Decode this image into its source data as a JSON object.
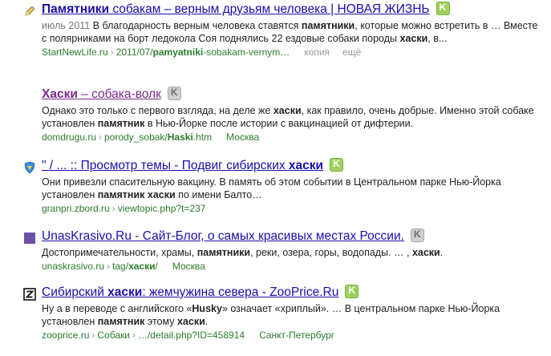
{
  "results": [
    {
      "title_parts": [
        {
          "text": "Памятники",
          "bold": true
        },
        {
          "text": " собакам – верным друзьям человека | НОВАЯ ЖИЗНЬ",
          "bold": false
        }
      ],
      "visited": false,
      "bookmark_color": "green",
      "favicon": "pencil-icon",
      "snippet_parts": [
        {
          "text": "июль 2011",
          "date": true
        },
        {
          "text": " В благодарность верным человека ставятся "
        },
        {
          "text": "памятники",
          "bold": true
        },
        {
          "text": ", которые можно встретить в … Вместе с полярниками на борт ледокола Соя поднялись 22 ездовые собаки породы "
        },
        {
          "text": "хаски",
          "bold": true
        },
        {
          "text": ", в..."
        }
      ],
      "url_parts": [
        {
          "text": "StartNewLife.ru"
        },
        {
          "text": "›",
          "chev": true
        },
        {
          "text": "2011/07/"
        },
        {
          "text": "pamyatniki",
          "bold": true
        },
        {
          "text": "-sobakam-vernym…"
        }
      ],
      "extra": "копия",
      "more": "ещё"
    },
    {
      "title_parts": [
        {
          "text": "Хаски",
          "bold": true
        },
        {
          "text": " – собака-волк",
          "bold": false
        }
      ],
      "visited": true,
      "bookmark_color": "gray",
      "favicon": "",
      "snippet_parts": [
        {
          "text": "Однако это только с первого взгляда, на деле же "
        },
        {
          "text": "хаски",
          "bold": true
        },
        {
          "text": ", как правило, очень добрые. Именно этой собаке установлен "
        },
        {
          "text": "памятник",
          "bold": true
        },
        {
          "text": " в Нью-Йорке после истории с вакцинацией от дифтерии."
        }
      ],
      "url_parts": [
        {
          "text": "domdrugu.ru"
        },
        {
          "text": "›",
          "chev": true
        },
        {
          "text": "porody_sobak/"
        },
        {
          "text": "Haski",
          "bold": true
        },
        {
          "text": ".htm"
        }
      ],
      "extra": "Москва",
      "more": ""
    },
    {
      "title_parts": [
        {
          "text": "\" / ... :: Просмотр темы - Подвиг сибирских ",
          "bold": false
        },
        {
          "text": "хаски",
          "bold": true
        }
      ],
      "visited": false,
      "bookmark_color": "green",
      "favicon": "shield-icon",
      "snippet_parts": [
        {
          "text": "Они привезли спасительную вакцину. В память об этом событии в Центральном парке Нью-Йорка установлен "
        },
        {
          "text": "памятник",
          "bold": true
        },
        {
          "text": " "
        },
        {
          "text": "хаски",
          "bold": true
        },
        {
          "text": " по имени Балто…"
        }
      ],
      "url_parts": [
        {
          "text": "granpri.zbord.ru"
        },
        {
          "text": "›",
          "chev": true
        },
        {
          "text": "viewtopic.php?t=237"
        }
      ],
      "extra": "",
      "more": ""
    },
    {
      "title_parts": [
        {
          "text": "UnasKrasivo.Ru - Сайт-Блог, о самых красивых местах России.",
          "bold": false
        }
      ],
      "visited": false,
      "bookmark_color": "gray",
      "favicon": "purple-square-icon",
      "snippet_parts": [
        {
          "text": "Достопримечательности, храмы, "
        },
        {
          "text": "памятники",
          "bold": true
        },
        {
          "text": ", реки, озера, горы, водопады. … , "
        },
        {
          "text": "хаски",
          "bold": true
        },
        {
          "text": "."
        }
      ],
      "url_parts": [
        {
          "text": "unaskrasivo.ru"
        },
        {
          "text": "›",
          "chev": true
        },
        {
          "text": "tag/"
        },
        {
          "text": "хаски",
          "bold": true
        },
        {
          "text": "/"
        }
      ],
      "extra": "Москва",
      "more": ""
    },
    {
      "title_parts": [
        {
          "text": "Сибирский ",
          "bold": false
        },
        {
          "text": "хаски",
          "bold": true
        },
        {
          "text": ": жемчужина севера - ZooPrice.Ru",
          "bold": false
        }
      ],
      "visited": false,
      "bookmark_color": "green",
      "favicon": "z-logo-icon",
      "snippet_parts": [
        {
          "text": "Ну а в переводе с английского «"
        },
        {
          "text": "Husky",
          "bold": true
        },
        {
          "text": "» означает «хриплый». … В центральном парке Нью-Йорка установлен "
        },
        {
          "text": "памятник",
          "bold": true
        },
        {
          "text": " этому "
        },
        {
          "text": "хаски",
          "bold": true
        },
        {
          "text": "."
        }
      ],
      "url_parts": [
        {
          "text": "zooprice.ru"
        },
        {
          "text": "›",
          "chev": true
        },
        {
          "text": "Собаки"
        },
        {
          "text": "›",
          "chev": true
        },
        {
          "text": "…/detail.php?ID=458914"
        }
      ],
      "extra": "Санкт-Петербург",
      "more": ""
    }
  ],
  "colors": {
    "link": "#1a0dab",
    "visited": "#7a2a8a",
    "url": "#2c7c2c",
    "bookmark_green": "#9ed05b",
    "bookmark_gray": "#cfcfcf"
  }
}
